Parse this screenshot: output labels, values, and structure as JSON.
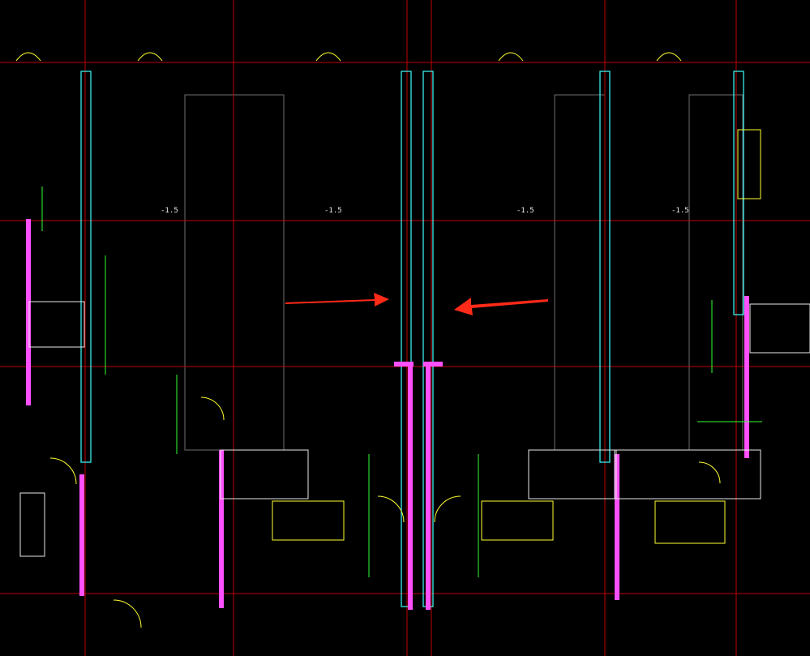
{
  "drawing": {
    "background": "#000000",
    "colors": {
      "red_axis": "#c00000",
      "magenta_wall": "#ff50ff",
      "white_line": "#e8e8e8",
      "yellow_line": "#ffff30",
      "green_dim": "#30ff30",
      "cyan_line": "#40ffff",
      "blue_text": "#7070ff",
      "hatch_grey": "#6f6f6f",
      "arrow_red": "#ff2a18"
    },
    "text_note": "",
    "labels": {
      "elevations": [
        "-1.5",
        "-1.5",
        "-1.5",
        "-1.5"
      ]
    }
  }
}
